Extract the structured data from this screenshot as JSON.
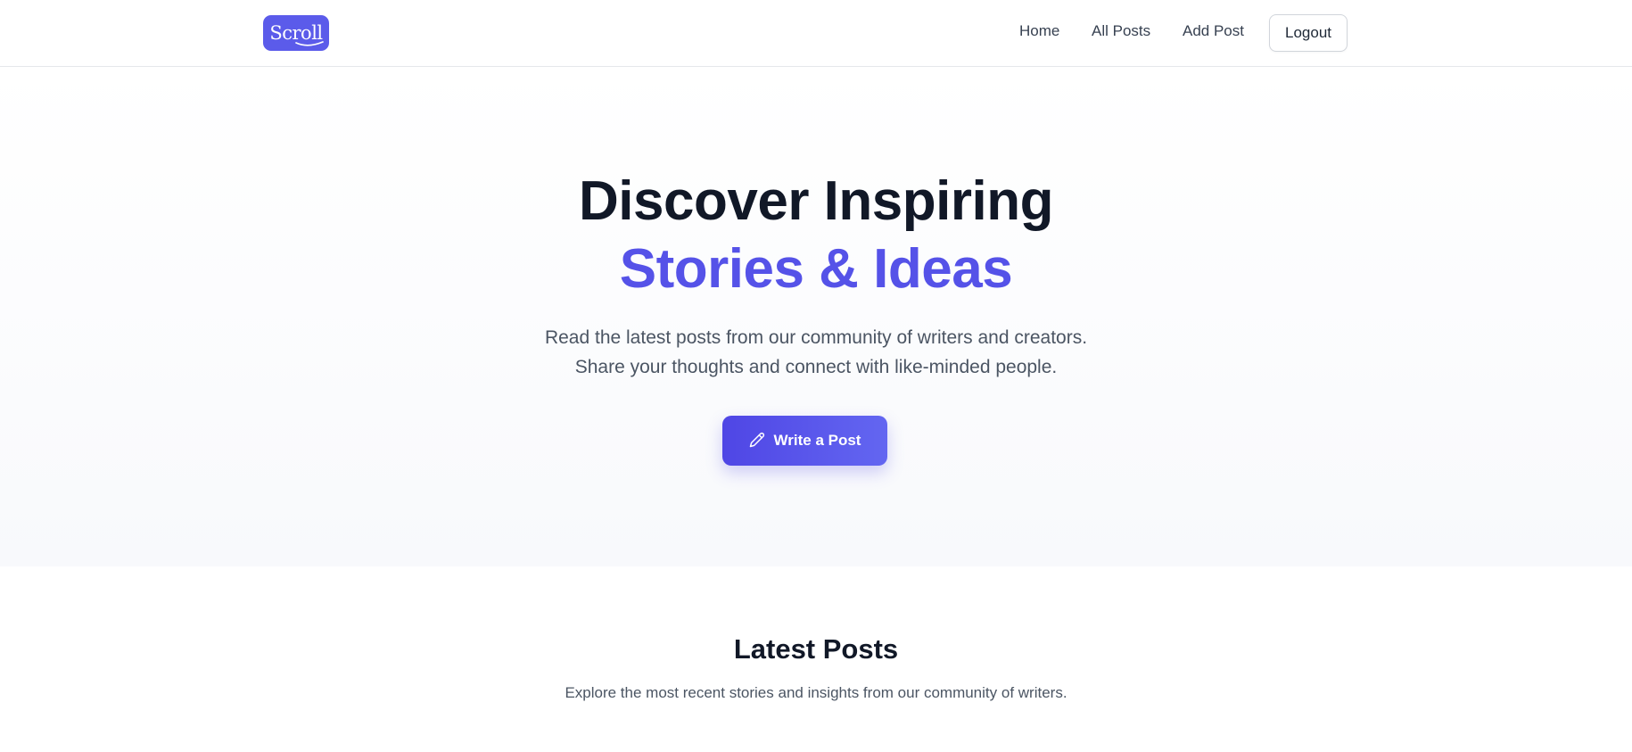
{
  "nav": {
    "logo_text": "Scroll",
    "links": [
      "Home",
      "All Posts",
      "Add Post"
    ],
    "logout_label": "Logout"
  },
  "hero": {
    "title_line1": "Discover Inspiring",
    "title_line2": "Stories & Ideas",
    "subtitle_line1": "Read the latest posts from our community of writers and creators.",
    "subtitle_line2": "Share your thoughts and connect with like-minded people.",
    "cta_label": "Write a Post",
    "cta_icon": "pencil-icon"
  },
  "latest": {
    "title": "Latest Posts",
    "subtitle": "Explore the most recent stories and insights from our community of writers."
  },
  "colors": {
    "brand": "#5b5bea",
    "accent_text": "#5552e8",
    "heading": "#111827",
    "body_text": "#4b5563"
  }
}
